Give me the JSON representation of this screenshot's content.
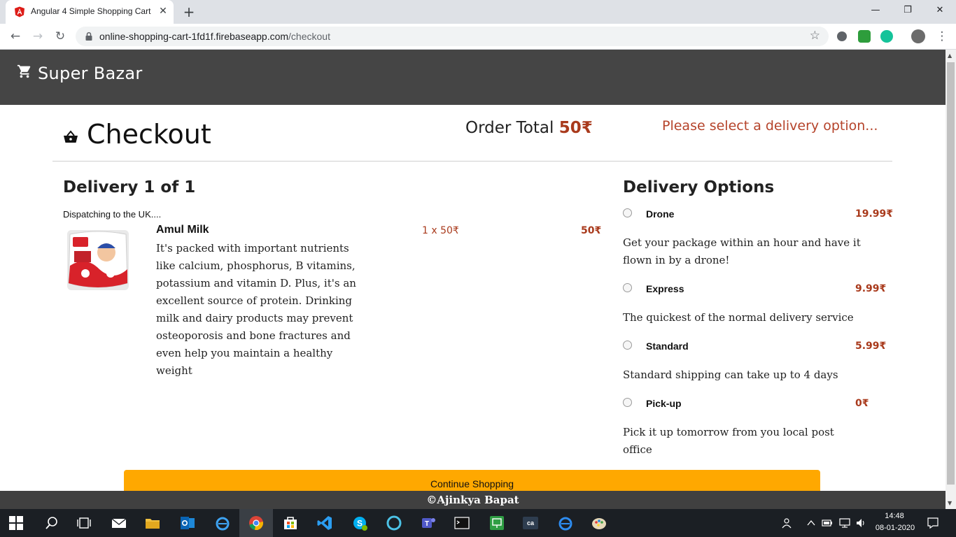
{
  "browser": {
    "tab_title": "Angular 4 Simple Shopping Cart",
    "tab_close": "✕",
    "new_tab": "+",
    "url_host": "online-shopping-cart-1fd1f.firebaseapp.com",
    "url_path": "/checkout",
    "window_minimize": "—",
    "window_maximize": "❐",
    "window_close": "✕"
  },
  "app": {
    "brand": "Super Bazar",
    "checkout_title": "Checkout",
    "order_total_label": "Order Total",
    "order_total_value": "50₹",
    "delivery_warning": "Please select a delivery option...",
    "delivery_heading": "Delivery 1 of 1",
    "dispatch_note": "Dispatching to the UK....",
    "product": {
      "name": "Amul Milk",
      "description": "It's packed with important nutrients like calcium, phosphorus, B vitamins, potassium and vitamin D. Plus, it's an excellent source of protein. Drinking milk and dairy products may prevent osteoporosis and bone fractures and even help you maintain a healthy weight",
      "quantity_price": "1 x 50₹",
      "line_total": "50₹"
    },
    "options_heading": "Delivery Options",
    "options": [
      {
        "name": "Drone",
        "price": "19.99₹",
        "description": "Get your package within an hour and have it flown in by a drone!"
      },
      {
        "name": "Express",
        "price": "9.99₹",
        "description": "The quickest of the normal delivery service"
      },
      {
        "name": "Standard",
        "price": "5.99₹",
        "description": "Standard shipping can take up to 4 days"
      },
      {
        "name": "Pick-up",
        "price": "0₹",
        "description": "Pick it up tomorrow from you local post office"
      }
    ],
    "continue_label": "Continue Shopping",
    "footer": "©Ajinkya Bapat"
  },
  "taskbar": {
    "time": "14:48",
    "date": "08-01-2020"
  },
  "colors": {
    "navbar": "#454545",
    "accent_price": "#a93a1c",
    "warning": "#b5432a",
    "button": "#ffa800",
    "footer": "#404040"
  }
}
